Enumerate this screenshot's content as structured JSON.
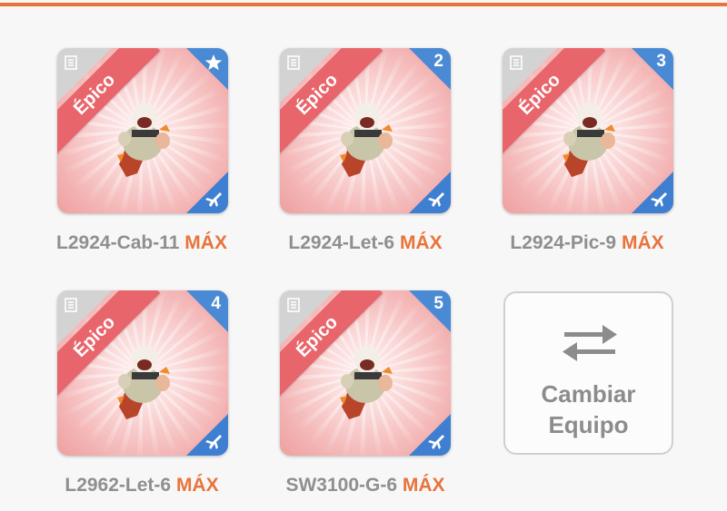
{
  "units": [
    {
      "name": "L2924-Cab-11",
      "level_tag": "MÁX",
      "rarity": "Épico",
      "slot_badge": "",
      "slot_icon": "star-icon",
      "is_leader": true
    },
    {
      "name": "L2924-Let-6",
      "level_tag": "MÁX",
      "rarity": "Épico",
      "slot_badge": "2",
      "slot_icon": "",
      "is_leader": false
    },
    {
      "name": "L2924-Pic-9",
      "level_tag": "MÁX",
      "rarity": "Épico",
      "slot_badge": "3",
      "slot_icon": "",
      "is_leader": false
    },
    {
      "name": "L2962-Let-6",
      "level_tag": "MÁX",
      "rarity": "Épico",
      "slot_badge": "4",
      "slot_icon": "",
      "is_leader": false
    },
    {
      "name": "SW3100-G-6",
      "level_tag": "MÁX",
      "rarity": "Épico",
      "slot_badge": "5",
      "slot_icon": "",
      "is_leader": false
    }
  ],
  "swap_button": {
    "line1": "Cambiar",
    "line2": "Equipo",
    "icon": "swap-arrows-icon"
  },
  "colors": {
    "accent": "#e8743c",
    "rarity_ribbon": "#e8656b",
    "badge_blue": "#4a8ad4",
    "name_grey": "#8f8f8f"
  }
}
